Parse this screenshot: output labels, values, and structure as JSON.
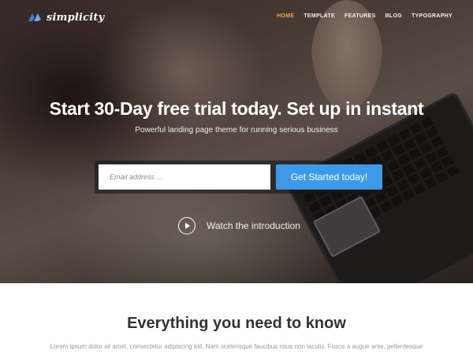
{
  "brand": {
    "name": "simplicity",
    "accent": "#f2a44a",
    "logo_color": "#3d7fd6"
  },
  "nav": {
    "items": [
      {
        "label": "HOME",
        "active": true
      },
      {
        "label": "TEMPLATE",
        "active": false
      },
      {
        "label": "FEATURES",
        "active": false
      },
      {
        "label": "BLOG",
        "active": false
      },
      {
        "label": "TYPOGRAPHY",
        "active": false
      }
    ]
  },
  "hero": {
    "headline": "Start 30-Day free trial today. Set up in instant",
    "subheadline": "Powerful landing page theme for running serious business",
    "email_placeholder": "Email address ...",
    "cta_label": "Get Started today!",
    "cta_color": "#3d9ae8",
    "watch_label": "Watch the introduction",
    "play_icon": "play-icon"
  },
  "section": {
    "title": "Everything you need to know",
    "text": "Lorem ipsum dolor sit amet, consectetur adipiscing elit. Nam scelerisque faucibus risus non iaculis. Fusce a augue ante, pellentesque"
  }
}
